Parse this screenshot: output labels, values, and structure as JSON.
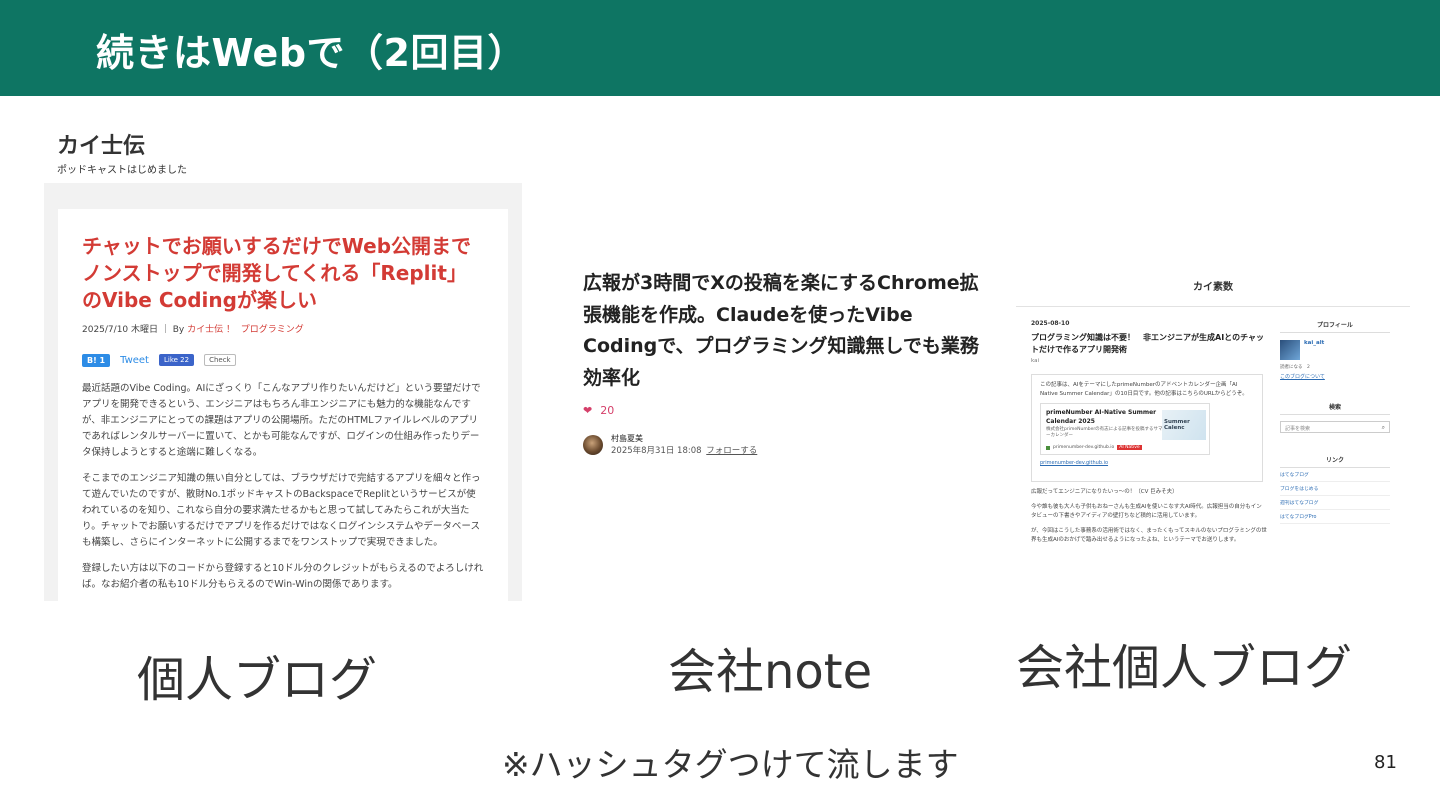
{
  "header": {
    "title": "続きはWebで（2回目）"
  },
  "blog": {
    "site_name": "カイ士伝",
    "tagline": "ポッドキャストはじめました",
    "title": "チャットでお願いするだけでWeb公開までノンストップで開発してくれる「Replit」のVibe Codingが楽しい",
    "meta_prefix": "2025/7/10 木曜日 ｜ By ",
    "meta_author": "カイ士伝 ！",
    "meta_category": "プログラミング",
    "share": {
      "hatena": "B! 1",
      "tweet": "Tweet",
      "like": "Like 22",
      "check": "Check"
    },
    "paragraphs": [
      "最近話題のVibe Coding。AIにざっくり「こんなアプリ作りたいんだけど」という要望だけでアプリを開発できるという、エンジニアはもちろん非エンジニアにも魅力的な機能なんですが、非エンジニアにとっての課題はアプリの公開場所。ただのHTMLファイルレベルのアプリであればレンタルサーバーに置いて、とかも可能なんですが、ログインの仕組み作ったりデータ保持しようとすると途端に難しくなる。",
      "そこまでのエンジニア知識の無い自分としては、ブラウザだけで完結するアプリを細々と作って遊んでいたのですが、散財No.1ポッドキャストのBackspaceでReplitというサービスが使われているのを知り、これなら自分の要求満たせるかもと思って試してみたらこれが大当たり。チャットでお願いするだけでアプリを作るだけではなくログインシステムやデータベースも構築し、さらにインターネットに公開するまでをワンストップで実現できました。",
      "登録したい方は以下のコードから登録すると10ドル分のクレジットがもらえるのでよろしければ。なお紹介者の私も10ドル分もらえるのでWin-Winの関係であります。"
    ]
  },
  "note": {
    "title": "広報が3時間でXの投稿を楽にするChrome拡張機能を作成。Claudeを使ったVibe Codingで、プログラミング知識無しでも業務効率化",
    "likes": "20",
    "author": "村島夏美",
    "date": "2025年8月31日 18:08",
    "follow": "フォローする"
  },
  "kai": {
    "site_name": "カイ素数",
    "date": "2025-08-10",
    "title": "プログラミング知識は不要！　非エンジニアが生成AIとのチャットだけで作るアプリ開発術",
    "author": "kai",
    "box_text": "この記事は、AIをテーマにしたprimeNumberのアドベントカレンダー企画「AI Native Summer Calendar」の10日目です。他の記事はこちらのURLからどうぞ。",
    "embed_title": "primeNumber AI-Native Summer Calendar 2025",
    "embed_desc": "株式会社primeNumberの有志による記事を投稿するサマーカレンダー",
    "embed_image_text": "Summer Calenc",
    "embed_domain": "primenumber-dev.github.io",
    "embed_badge": "AI Native",
    "link": "primenumber-dev.github.io",
    "para1": "広報だってエンジニアになりたいっ〜の！（CV 巨みそ夫）",
    "para2": "今や誰も彼も大人も子供もおねーさんも生成AIを使いこなす大AI時代。広報担当の自分もインタビューの下書きやアイディアの壁打ちなど積的に活用しています。",
    "para3": "が、今回はこうした事務系の活用術ではなく、まったくもってスキルのないプログラミングの世界も生成AIのおかげで踏み出せるようになったよね、というテーマでお送りします。",
    "sidebar": {
      "profile_heading": "プロフィール",
      "profile_name": "kai_alt",
      "profile_small": "読者になる　2",
      "profile_about": "このブログについて",
      "search_heading": "検索",
      "search_placeholder": "記事を検索",
      "links_heading": "リンク",
      "links": [
        "はてなブログ",
        "ブログをはじめる",
        "週刊はてなブログ",
        "はてなブログPro"
      ]
    }
  },
  "captions": {
    "personal_blog": "個人ブログ",
    "company_note": "会社note",
    "company_personal_blog": "会社個人ブログ",
    "hashtag_note": "※ハッシュタグつけて流します"
  },
  "page_number": "81"
}
